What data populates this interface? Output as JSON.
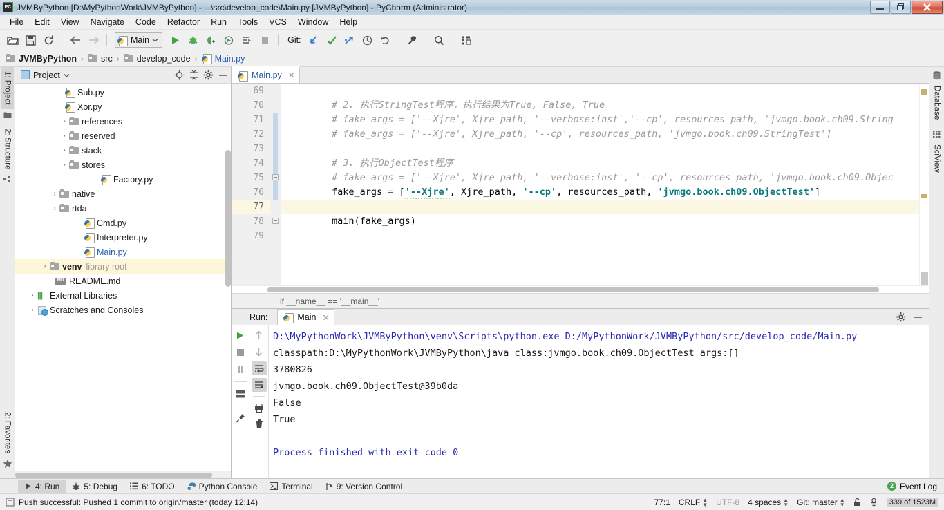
{
  "window": {
    "title": "JVMByPython [D:\\MyPythonWork\\JVMByPython] - ...\\src\\develop_code\\Main.py [JVMByPython] - PyCharm (Administrator)",
    "app_icon": "pycharm-icon",
    "minimize_label": "",
    "restore_label": "❐",
    "close_label": "✕"
  },
  "menubar": {
    "items": [
      {
        "label": "File"
      },
      {
        "label": "Edit"
      },
      {
        "label": "View"
      },
      {
        "label": "Navigate"
      },
      {
        "label": "Code"
      },
      {
        "label": "Refactor"
      },
      {
        "label": "Run"
      },
      {
        "label": "Tools"
      },
      {
        "label": "VCS"
      },
      {
        "label": "Window"
      },
      {
        "label": "Help"
      }
    ]
  },
  "toolbar": {
    "open_icon": "open-folder-icon",
    "save_icon": "save-icon",
    "sync_icon": "refresh-icon",
    "back_icon": "arrow-left-icon",
    "forward_icon": "arrow-right-icon",
    "run_config_name": "Main",
    "run_config_icon": "python-file-icon",
    "run_config_chevron": "chevron-down-icon",
    "run_icon": "run-icon",
    "debug_icon": "debug-icon",
    "coverage_icon": "run-coverage-icon",
    "profile_icon": "profile-icon",
    "runwith_icon": "run-with-icon",
    "stop_icon": "stop-icon",
    "git_label": "Git:",
    "update_icon": "vcs-update-icon",
    "commit_icon": "vcs-commit-icon",
    "push_icon": "vcs-push-icon",
    "history_icon": "history-icon",
    "rollback_icon": "rollback-icon",
    "settings_icon": "wrench-icon",
    "search_icon": "search-icon",
    "layout_icon": "project-structure-icon"
  },
  "breadcrumb": {
    "items": [
      {
        "label": "JVMByPython",
        "icon": "folder-icon",
        "kind": "project"
      },
      {
        "label": "src",
        "icon": "folder-icon",
        "kind": "folder"
      },
      {
        "label": "develop_code",
        "icon": "folder-icon",
        "kind": "folder"
      },
      {
        "label": "Main.py",
        "icon": "python-file-icon",
        "kind": "file"
      }
    ],
    "separator": "›"
  },
  "left_strip": {
    "tabs": [
      {
        "label": "1: Project",
        "icon": "project-icon",
        "active": true
      },
      {
        "label": "2: Structure",
        "icon": "structure-icon",
        "active": false
      },
      {
        "label": "2: Favorites",
        "icon": "star-icon",
        "active": false
      }
    ]
  },
  "right_strip": {
    "tabs": [
      {
        "label": "Database",
        "icon": "database-icon"
      },
      {
        "label": "SciView",
        "icon": "grid-icon"
      }
    ]
  },
  "project_panel": {
    "title": "Project",
    "title_chevron": "chevron-down-icon",
    "actions": [
      {
        "name": "locate-icon"
      },
      {
        "name": "collapse-all-icon"
      },
      {
        "name": "gear-icon"
      },
      {
        "name": "hide-icon"
      }
    ],
    "tree": [
      {
        "label": "Sub.py",
        "icon": "python-file-icon",
        "indent": 4,
        "arrow": "",
        "highlight": false,
        "blue": false
      },
      {
        "label": "Xor.py",
        "icon": "python-file-icon",
        "indent": 4,
        "arrow": "",
        "highlight": false,
        "blue": false
      },
      {
        "label": "references",
        "icon": "folder-icon",
        "indent": 3,
        "arrow": "›",
        "highlight": false,
        "blue": false
      },
      {
        "label": "reserved",
        "icon": "folder-icon",
        "indent": 3,
        "arrow": "›",
        "highlight": false,
        "blue": false
      },
      {
        "label": "stack",
        "icon": "folder-icon",
        "indent": 3,
        "arrow": "›",
        "highlight": false,
        "blue": false
      },
      {
        "label": "stores",
        "icon": "folder-icon",
        "indent": 3,
        "arrow": "›",
        "highlight": false,
        "blue": false
      },
      {
        "label": "Factory.py",
        "icon": "python-file-icon",
        "indent": 3,
        "arrow": "",
        "highlight": false,
        "blue": false
      },
      {
        "label": "native",
        "icon": "folder-icon",
        "indent": 2,
        "arrow": "›",
        "highlight": false,
        "blue": false
      },
      {
        "label": "rtda",
        "icon": "folder-icon",
        "indent": 2,
        "arrow": "›",
        "highlight": false,
        "blue": false
      },
      {
        "label": "Cmd.py",
        "icon": "python-file-icon",
        "indent": 3,
        "arrow": "",
        "highlight": false,
        "blue": false
      },
      {
        "label": "Interpreter.py",
        "icon": "python-file-icon",
        "indent": 3,
        "arrow": "",
        "highlight": false,
        "blue": false
      },
      {
        "label": "Main.py",
        "icon": "python-file-icon",
        "indent": 3,
        "arrow": "",
        "highlight": false,
        "blue": true
      },
      {
        "label": "venv",
        "icon": "folder-icon",
        "indent": 1,
        "arrow": "›",
        "highlight": true,
        "blue": false,
        "suffix": "library root"
      },
      {
        "label": "README.md",
        "icon": "markdown-file-icon",
        "indent": 2,
        "arrow": "",
        "highlight": false,
        "blue": false
      },
      {
        "label": "External Libraries",
        "icon": "external-libraries-icon",
        "indent": 0,
        "arrow": "›",
        "highlight": false,
        "blue": false
      },
      {
        "label": "Scratches and Consoles",
        "icon": "scratches-icon",
        "indent": 0,
        "arrow": "›",
        "highlight": false,
        "blue": false
      }
    ]
  },
  "editor": {
    "tab": {
      "label": "Main.py",
      "icon": "python-file-icon",
      "close": "✕"
    },
    "first_line_number": 69,
    "current_line": 77,
    "lines": [
      {
        "n": 69,
        "segments": []
      },
      {
        "n": 70,
        "segments": [
          {
            "t": "        # 2. 执行StringTest程序，执行结果为True, False, True",
            "c": "cm"
          }
        ]
      },
      {
        "n": 71,
        "segments": [
          {
            "t": "        # fake_args = ['--Xjre', Xjre_path, '--verbose:inst','--cp', resources_path, 'jvmgo.book.ch09.String",
            "c": "cm"
          }
        ]
      },
      {
        "n": 72,
        "segments": [
          {
            "t": "        # fake_args = ['--Xjre', Xjre_path, '--cp', resources_path, 'jvmgo.book.ch09.StringTest']",
            "c": "cm"
          }
        ]
      },
      {
        "n": 73,
        "segments": []
      },
      {
        "n": 74,
        "segments": [
          {
            "t": "        # 3. 执行ObjectTest程序",
            "c": "cm"
          }
        ]
      },
      {
        "n": 75,
        "segments": [
          {
            "t": "        # fake_args = ['--Xjre', Xjre_path, '--verbose:inst', '--cp', resources_path, 'jvmgo.book.ch09.Objec",
            "c": "cm"
          }
        ]
      },
      {
        "n": 76,
        "segments": [
          {
            "t": "        fake_args = [",
            "c": "kw"
          },
          {
            "t": "'--Xjre'",
            "c": "strb"
          },
          {
            "t": ", Xjre_path, ",
            "c": "kw"
          },
          {
            "t": "'--cp'",
            "c": "strb"
          },
          {
            "t": ", resources_path, ",
            "c": "kw"
          },
          {
            "t": "'jvmgo.book.ch09.ObjectTest'",
            "c": "strb"
          },
          {
            "t": "]",
            "c": "kw"
          }
        ]
      },
      {
        "n": 77,
        "segments": [],
        "caret": true
      },
      {
        "n": 78,
        "segments": [
          {
            "t": "        main(fake_args)",
            "c": "kw"
          }
        ]
      },
      {
        "n": 79,
        "segments": []
      }
    ],
    "breadcrumb_status": "if __name__ == '__main__'"
  },
  "run_panel": {
    "label": "Run:",
    "tab": {
      "label": "Main",
      "icon": "python-file-icon",
      "close": "✕"
    },
    "header_actions": [
      {
        "name": "gear-icon"
      },
      {
        "name": "hide-icon"
      }
    ],
    "tools_left": [
      {
        "name": "rerun-icon",
        "glyph": "▶"
      },
      {
        "name": "stop-icon",
        "glyph": "■"
      },
      {
        "name": "pause-icon",
        "glyph": "‖"
      },
      {
        "name": "restore-layout-icon",
        "glyph": "▤"
      },
      {
        "name": "pin-tab-icon",
        "glyph": "⚑"
      }
    ],
    "tools_right": [
      {
        "name": "scroll-up-icon",
        "glyph": "↑"
      },
      {
        "name": "scroll-down-icon",
        "glyph": "↓"
      },
      {
        "name": "soft-wrap-icon",
        "glyph": "↵"
      },
      {
        "name": "scroll-to-end-icon",
        "glyph": "↧"
      },
      {
        "name": "print-icon",
        "glyph": "⎙"
      },
      {
        "name": "clear-all-icon",
        "glyph": "🗑"
      }
    ],
    "console_lines": [
      {
        "text": "D:\\MyPythonWork\\JVMByPython\\venv\\Scripts\\python.exe D:/MyPythonWork/JVMByPython/src/develop_code/Main.py",
        "style": "blue"
      },
      {
        "text": "classpath:D:\\MyPythonWork\\JVMByPython\\java class:jvmgo.book.ch09.ObjectTest args:[]",
        "style": "dark"
      },
      {
        "text": "3780826",
        "style": "dark"
      },
      {
        "text": "jvmgo.book.ch09.ObjectTest@39b0da",
        "style": "dark"
      },
      {
        "text": "False",
        "style": "dark"
      },
      {
        "text": "True",
        "style": "dark"
      },
      {
        "text": "",
        "style": "dark"
      },
      {
        "text": "Process finished with exit code 0",
        "style": "blue"
      }
    ]
  },
  "toolwindow_bar": {
    "items": [
      {
        "label": "4: Run",
        "icon": "run-icon",
        "active": true
      },
      {
        "label": "5: Debug",
        "icon": "debug-icon",
        "active": false
      },
      {
        "label": "6: TODO",
        "icon": "todo-icon",
        "active": false
      },
      {
        "label": "Python Console",
        "icon": "python-console-icon",
        "active": false
      },
      {
        "label": "Terminal",
        "icon": "terminal-icon",
        "active": false
      },
      {
        "label": "9: Version Control",
        "icon": "version-control-icon",
        "active": false
      }
    ],
    "event_log": {
      "label": "Event Log",
      "count": "2"
    }
  },
  "statusbar": {
    "message_icon": "notification-icon",
    "message": "Push successful: Pushed 1 commit to origin/master (today 12:14)",
    "caret_position": "77:1",
    "line_separator": "CRLF",
    "encoding": "UTF-8",
    "indent": "4 spaces",
    "git_branch": "Git: master",
    "lock_icon": "lock-icon",
    "inspection_icon": "inspector-icon",
    "memory": "339 of 1523M"
  },
  "colors": {
    "accent_blue": "#2a5db0",
    "string_teal": "#0a7a78",
    "comment_gray": "#9a9a9a",
    "highlight_yellow": "#fdf6d8",
    "caret_line": "#fcf7e2",
    "console_blue": "#2a2ab0",
    "badge_green": "#4aa350"
  }
}
